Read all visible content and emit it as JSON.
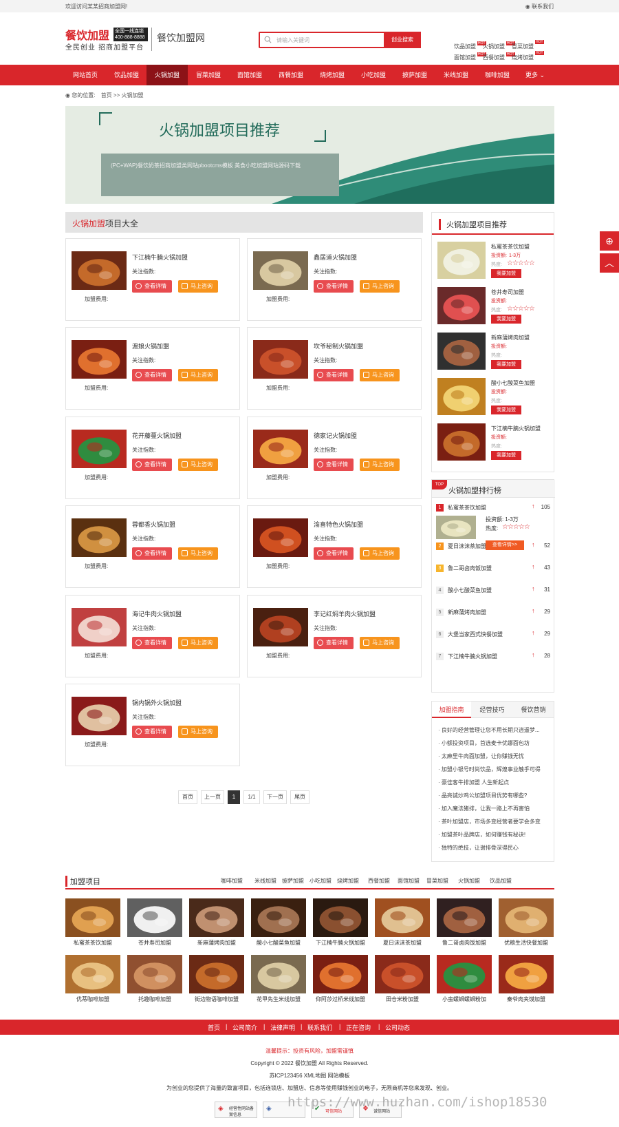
{
  "topbar": {
    "welcome": "欢迎访问某某招商加盟网!",
    "contact": "联系我们"
  },
  "logo": {
    "brand": "餐饮加盟",
    "tag1": "全国一线连锁",
    "phone": "400-888-8888",
    "slogan": "全民创业 招商加盟平台",
    "site_name": "餐饮加盟网"
  },
  "search": {
    "placeholder": "请输入关键词",
    "button": "创业搜索"
  },
  "hot_links": [
    "饮品加盟",
    "火锅加盟",
    "冒菜加盟",
    "面馆加盟",
    "西餐加盟",
    "烧烤加盟"
  ],
  "hot_badge": "HOT",
  "nav": [
    "网站首页",
    "饮品加盟",
    "火锅加盟",
    "冒菜加盟",
    "面馆加盟",
    "西餐加盟",
    "烧烤加盟",
    "小吃加盟",
    "披萨加盟",
    "米线加盟",
    "咖啡加盟",
    "更多"
  ],
  "breadcrumb": {
    "label": "您的位置:",
    "home": "首页",
    "sep": ">>",
    "current": "火锅加盟"
  },
  "banner": {
    "title": "火锅加盟项目推荐",
    "desc": "(PC+WAP)餐饮奶茶招商加盟类网站pbootcms模板 美食小吃加盟网站源码下载"
  },
  "section": {
    "title_red": "火锅加盟",
    "title_rest": "项目大全"
  },
  "card_labels": {
    "attention": "关注指数:",
    "fee": "加盟费用:",
    "detail": "查看详情",
    "consult": "马上咨询"
  },
  "projects": [
    "下江楠牛腩火锅加盟",
    "鑫居道火锅加盟",
    "渡娘火锅加盟",
    "坎爷秘制火锅加盟",
    "花开藤蔓火锅加盟",
    "德家记火锅加盟",
    "蓉都香火锅加盟",
    "渝喜特色火锅加盟",
    "海记牛肉火锅加盟",
    "李记红焖羊肉火锅加盟",
    "锅内锅外火锅加盟"
  ],
  "pagination": [
    "首页",
    "上一页",
    "1",
    "1/1",
    "下一页",
    "尾页"
  ],
  "sidebar_rec": {
    "title": "火锅加盟项目推荐",
    "invest_label": "投资额:",
    "hot_label": "热度:",
    "join": "我要加盟",
    "stars": "☆☆☆☆☆",
    "items": [
      {
        "name": "私蜜茶茶饮加盟",
        "invest": "1-3万"
      },
      {
        "name": "苍井寿司加盟",
        "invest": ""
      },
      {
        "name": "新麻蒲烤肉加盟",
        "invest": ""
      },
      {
        "name": "酸小七酸菜鱼加盟",
        "invest": ""
      },
      {
        "name": "下江楠牛腩火锅加盟",
        "invest": ""
      }
    ]
  },
  "ranking": {
    "title": "火锅加盟排行榜",
    "top": "TOP",
    "invest_label": "投资额:",
    "invest": "1-3万",
    "hot_label": "热度:",
    "stars": "☆☆☆☆☆",
    "detail": "查看详情>>",
    "items": [
      {
        "name": "私蜜茶茶饮加盟",
        "count": "105"
      },
      {
        "name": "夏日沫沫茶加盟",
        "count": "52"
      },
      {
        "name": "鲁二哥卤肉饭加盟",
        "count": "43"
      },
      {
        "name": "酸小七酸菜鱼加盟",
        "count": "31"
      },
      {
        "name": "新麻蒲烤肉加盟",
        "count": "29"
      },
      {
        "name": "大堡当家西式快餐加盟",
        "count": "29"
      },
      {
        "name": "下江楠牛腩火锅加盟",
        "count": "28"
      }
    ]
  },
  "tabs": [
    "加盟指南",
    "经营技巧",
    "餐饮营销"
  ],
  "news": [
    "良好的经营管理让您不用长期只逍遥梦...",
    "小额投资项目，首选麦卡优娜面包坊",
    "太麻里牛肉面加盟，让你赚钱无忧",
    "加盟小银号时尚饮品，辉煌事业触手可得",
    "豪佳客牛排加盟 人生新起点",
    "品亮诚炒鸡公加盟项目优势有哪些?",
    "加入魔法猪排，让我一路上不再害怕",
    "茶叶加盟店，市场多变经营者要学会多变",
    "加盟茶叶品牌店，如何赚钱有秘诀!",
    "独特的绝技，让谢排骨深得民心"
  ],
  "project_block": {
    "title": "加盟项目",
    "cats": [
      "咖啡加盟",
      "米线加盟",
      "披萨加盟",
      "小吃加盟",
      "烧烤加盟",
      "西餐加盟",
      "面馆加盟",
      "冒菜加盟",
      "火锅加盟",
      "饮品加盟"
    ],
    "items": [
      "私蜜茶茶饮加盟",
      "苍井寿司加盟",
      "新麻蒲烤肉加盟",
      "酸小七酸菜鱼加盟",
      "下江楠牛腩火锅加盟",
      "夏日沫沫茶加盟",
      "鲁二哥卤肉饭加盟",
      "优粮生活快餐加盟",
      "优蒂咖啡加盟",
      "托趣咖啡加盟",
      "街边物语咖啡加盟",
      "花甲先生米线加盟",
      "仰阿莎过桥米线加盟",
      "田仓米粉加盟",
      "小蛮螺蛳螺蛳粉加",
      "秦爷肉夹馍加盟"
    ]
  },
  "footer": {
    "links": [
      "首页",
      "公司简介",
      "法律声明",
      "联系我们",
      "正在咨询",
      "公司动态"
    ],
    "sep": "|",
    "warning": "温馨提示：投资有风险，加盟需谨慎",
    "copyright": "Copyright © 2022 餐饮加盟 All Rights Reserved.",
    "icp": "苏ICP123456 XML地图 网站模板",
    "desc": "为创业的您提供了海量的致富项目，包括连锁店、加盟店、信息等使用赚钱创业的电子，无限商机等您来发现、创业。",
    "badges": [
      "经营性网站备案信息",
      "",
      "可信网站",
      "诚信网站"
    ]
  },
  "watermark": "https://www.huzhan.com/ishop18530",
  "colors": {
    "brand_red": "#d9262b",
    "dark_red": "#8c1217",
    "orange": "#f7941d"
  }
}
